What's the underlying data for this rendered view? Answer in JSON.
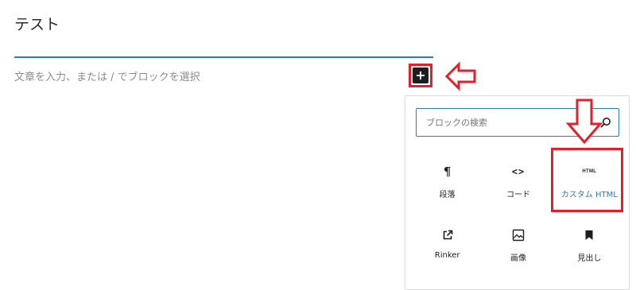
{
  "editor": {
    "title": "テスト",
    "placeholder": "文章を入力、または / でブロックを選択"
  },
  "inserter": {
    "icon": "plus-icon"
  },
  "annotations": {
    "arrow_color": "#e0202a"
  },
  "popover": {
    "search": {
      "placeholder": "ブロックの検索",
      "value": "",
      "icon": "search-icon"
    },
    "blocks": [
      {
        "label": "段落",
        "icon": "paragraph-icon",
        "glyph": "¶"
      },
      {
        "label": "コード",
        "icon": "code-icon",
        "glyph": "<>"
      },
      {
        "label": "カスタム HTML",
        "icon": "html-icon",
        "glyph": "HTML",
        "highlighted": true
      },
      {
        "label": "Rinker",
        "icon": "external-link-icon"
      },
      {
        "label": "画像",
        "icon": "image-icon"
      },
      {
        "label": "見出し",
        "icon": "bookmark-icon"
      }
    ]
  },
  "colors": {
    "accent": "#2a7db8",
    "annotation": "#e0202a",
    "text": "#1e1e1e",
    "placeholder": "#8c8c8c"
  }
}
